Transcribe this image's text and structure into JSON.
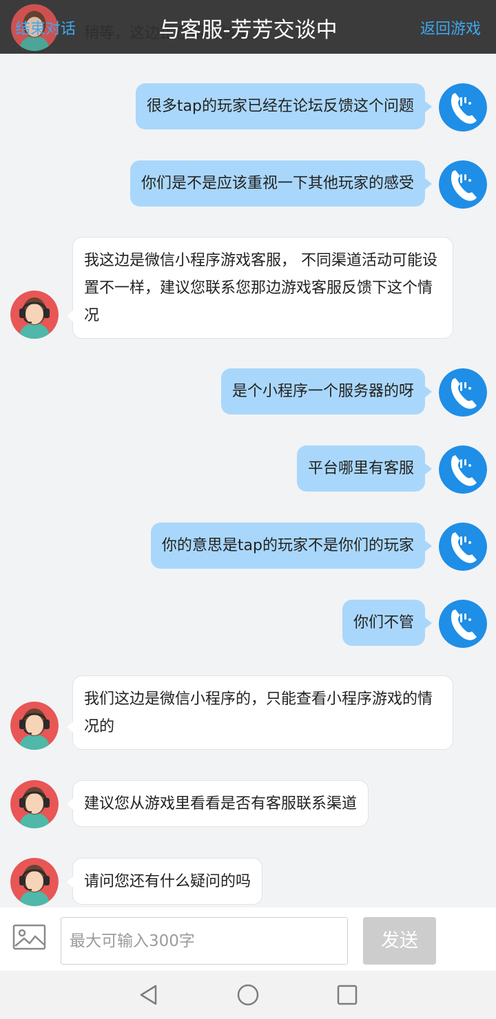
{
  "header": {
    "end_chat": "结束对话",
    "title": "与客服-芳芳交谈中",
    "back_game": "返回游戏",
    "peek_text": "稍等，这边正在帮您核实"
  },
  "messages": [
    {
      "from": "user",
      "text": "很多tap的玩家已经在论坛反馈这个问题"
    },
    {
      "from": "user",
      "text": "你们是不是应该重视一下其他玩家的感受"
    },
    {
      "from": "agent",
      "text": "我这边是微信小程序游戏客服， 不同渠道活动可能设置不一样，建议您联系您那边游戏客服反馈下这个情况"
    },
    {
      "from": "user",
      "text": "是个小程序一个服务器的呀"
    },
    {
      "from": "user",
      "text": "平台哪里有客服"
    },
    {
      "from": "user",
      "text": "你的意思是tap的玩家不是你们的玩家"
    },
    {
      "from": "user",
      "text": "你们不管"
    },
    {
      "from": "agent",
      "text": "我们这边是微信小程序的，只能查看小程序游戏的情况的"
    },
    {
      "from": "agent",
      "text": "建议您从游戏里看看是否有客服联系渠道"
    },
    {
      "from": "agent",
      "text": "请问您还有什么疑问的吗"
    }
  ],
  "input": {
    "placeholder": "最大可输入300字",
    "send_label": "发送",
    "image_icon": "image-icon"
  },
  "navbar": {
    "icons": [
      "back-triangle-icon",
      "home-circle-icon",
      "recents-square-icon"
    ]
  },
  "colors": {
    "header_bg": "#3b3b3b",
    "link_blue": "#3ea8ee",
    "user_bubble": "#a9d7fb",
    "agent_bubble": "#ffffff",
    "chat_bg": "#f2f3f5",
    "send_disabled": "#cdcdcd"
  }
}
